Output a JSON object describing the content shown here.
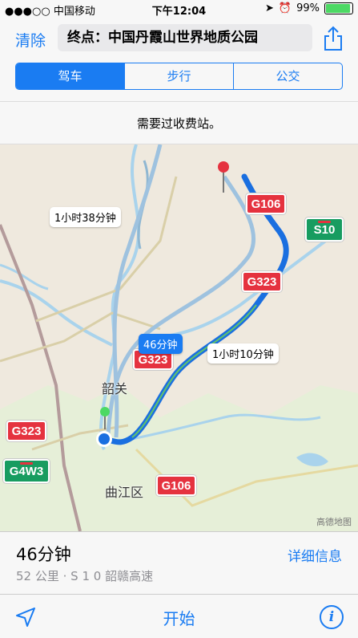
{
  "status": {
    "carrier": "●●●○○ 中国移动",
    "time": "下午12:04",
    "battery": "99%"
  },
  "nav": {
    "clear_label": "清除",
    "destination": "终点：中国丹霞山世界地质公园",
    "tabs": [
      {
        "label": "驾车",
        "active": true
      },
      {
        "label": "步行"
      },
      {
        "label": "公交"
      }
    ]
  },
  "notice": "需要过收费站。",
  "map": {
    "shields": {
      "g106_top": "G106",
      "s10": "S10",
      "g323_right": "G323",
      "g323_mid": "G323",
      "g323_left": "G323",
      "g4w3": "G4W3",
      "g106_bottom": "G106"
    },
    "bubbles": {
      "alt1": "1小时38分钟",
      "main": "46分钟",
      "alt2": "1小时10分钟"
    },
    "places": {
      "shaoguan": "韶关",
      "qujiang": "曲江区"
    },
    "attribution": "高德地图"
  },
  "route": {
    "eta": "46分钟",
    "detail": "52 公里 · S 1 0 韶赣高速",
    "more_label": "详细信息"
  },
  "toolbar": {
    "start_label": "开始"
  }
}
